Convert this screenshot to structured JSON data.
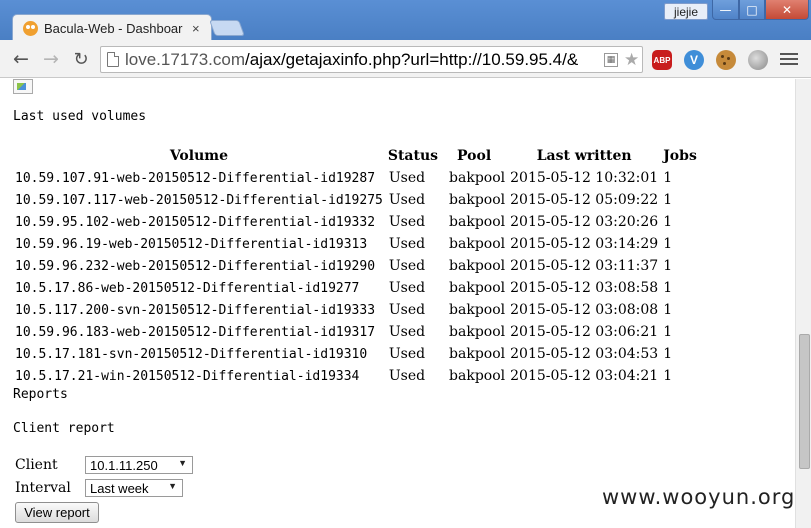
{
  "browser": {
    "tab_title": "Bacula-Web - Dashboar",
    "tab_close": "×",
    "user_label": "jiejie",
    "window_buttons": {
      "minimize": "—",
      "maximize": "□",
      "close": "✕"
    },
    "url_scheme": "love.17173.com",
    "url_rest": "/ajax/getajaxinfo.php?url=http://10.59.95.4/&",
    "extensions": {
      "abp": "ABP",
      "v": "V"
    }
  },
  "page": {
    "last_used_heading": "Last used volumes",
    "table": {
      "headers": [
        "Volume",
        "Status",
        "Pool",
        "Last written",
        "Jobs"
      ],
      "rows": [
        [
          "10.59.107.91-web-20150512-Differential-id19287",
          "Used",
          "bakpool",
          "2015-05-12  10:32:01",
          "1"
        ],
        [
          "10.59.107.117-web-20150512-Differential-id19275",
          "Used",
          "bakpool",
          "2015-05-12  05:09:22",
          "1"
        ],
        [
          "10.59.95.102-web-20150512-Differential-id19332",
          "Used",
          "bakpool",
          "2015-05-12  03:20:26",
          "1"
        ],
        [
          "10.59.96.19-web-20150512-Differential-id19313",
          "Used",
          "bakpool",
          "2015-05-12  03:14:29",
          "1"
        ],
        [
          "10.59.96.232-web-20150512-Differential-id19290",
          "Used",
          "bakpool",
          "2015-05-12  03:11:37",
          "1"
        ],
        [
          "10.5.17.86-web-20150512-Differential-id19277",
          "Used",
          "bakpool",
          "2015-05-12  03:08:58",
          "1"
        ],
        [
          "10.5.117.200-svn-20150512-Differential-id19333",
          "Used",
          "bakpool",
          "2015-05-12  03:08:08",
          "1"
        ],
        [
          "10.59.96.183-web-20150512-Differential-id19317",
          "Used",
          "bakpool",
          "2015-05-12  03:06:21",
          "1"
        ],
        [
          "10.5.17.181-svn-20150512-Differential-id19310",
          "Used",
          "bakpool",
          "2015-05-12  03:04:53",
          "1"
        ],
        [
          "10.5.17.21-win-20150512-Differential-id19334",
          "Used",
          "bakpool",
          "2015-05-12  03:04:21",
          "1"
        ]
      ]
    },
    "reports_heading": "Reports",
    "client_report_heading": "Client report",
    "client_label": "Client",
    "client_value": "10.1.11.250",
    "interval_label": "Interval",
    "interval_value": "Last week",
    "view_button": "View report"
  },
  "watermark": "www.wooyun.org"
}
